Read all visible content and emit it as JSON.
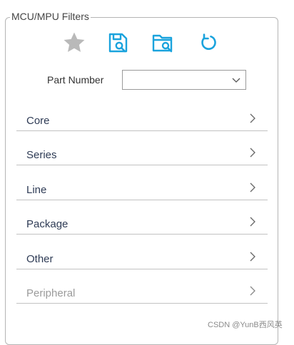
{
  "panel": {
    "title": "MCU/MPU Filters"
  },
  "toolbar": {
    "buttons": [
      {
        "icon": "star-icon",
        "color": "#b9b9b9"
      },
      {
        "icon": "save-search-icon",
        "color": "#1aa3dd"
      },
      {
        "icon": "open-folder-search-icon",
        "color": "#1aa3dd"
      },
      {
        "icon": "reset-icon",
        "color": "#1aa3dd"
      }
    ]
  },
  "part_number": {
    "label": "Part Number",
    "value": ""
  },
  "filters": [
    {
      "label": "Core",
      "enabled": true
    },
    {
      "label": "Series",
      "enabled": true
    },
    {
      "label": "Line",
      "enabled": true
    },
    {
      "label": "Package",
      "enabled": true
    },
    {
      "label": "Other",
      "enabled": true
    },
    {
      "label": "Peripheral",
      "enabled": false
    }
  ],
  "watermark": "CSDN @YunB西风英"
}
